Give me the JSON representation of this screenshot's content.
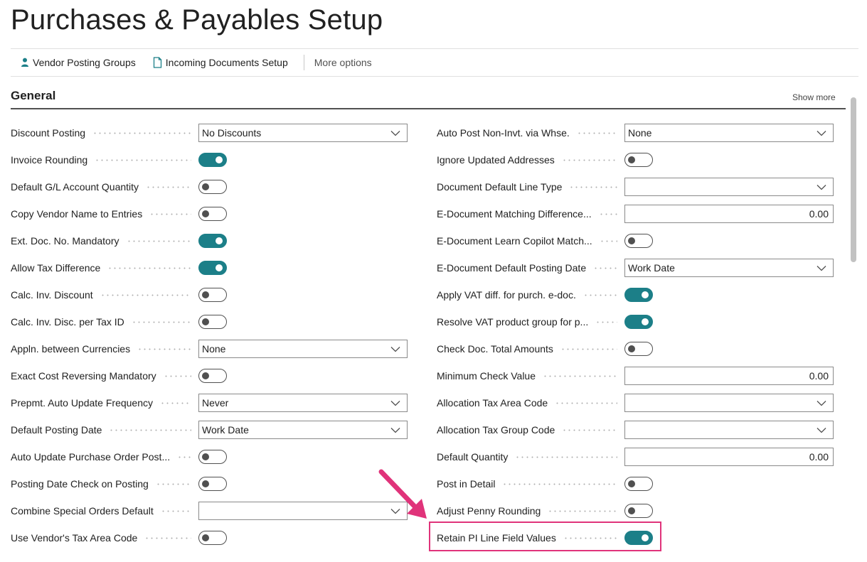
{
  "page": {
    "title": "Purchases & Payables Setup"
  },
  "actions": {
    "vendor_posting_groups": "Vendor Posting Groups",
    "incoming_documents_setup": "Incoming Documents Setup",
    "more_options": "More options"
  },
  "section": {
    "title": "General",
    "show_more": "Show more"
  },
  "left_fields": [
    {
      "name": "discount-posting",
      "label": "Discount Posting",
      "type": "select",
      "value": "No Discounts"
    },
    {
      "name": "invoice-rounding",
      "label": "Invoice Rounding",
      "type": "toggle",
      "on": true
    },
    {
      "name": "default-gl-account-quantity",
      "label": "Default G/L Account Quantity",
      "type": "toggle",
      "on": false
    },
    {
      "name": "copy-vendor-name-to-entries",
      "label": "Copy Vendor Name to Entries",
      "type": "toggle",
      "on": false
    },
    {
      "name": "ext-doc-no-mandatory",
      "label": "Ext. Doc. No. Mandatory",
      "type": "toggle",
      "on": true
    },
    {
      "name": "allow-tax-difference",
      "label": "Allow Tax Difference",
      "type": "toggle",
      "on": true
    },
    {
      "name": "calc-inv-discount",
      "label": "Calc. Inv. Discount",
      "type": "toggle",
      "on": false
    },
    {
      "name": "calc-inv-disc-per-tax-id",
      "label": "Calc. Inv. Disc. per Tax ID",
      "type": "toggle",
      "on": false
    },
    {
      "name": "appln-between-currencies",
      "label": "Appln. between Currencies",
      "type": "select",
      "value": "None"
    },
    {
      "name": "exact-cost-reversing-mandatory",
      "label": "Exact Cost Reversing Mandatory",
      "type": "toggle",
      "on": false
    },
    {
      "name": "prepmt-auto-update-frequency",
      "label": "Prepmt. Auto Update Frequency",
      "type": "select",
      "value": "Never"
    },
    {
      "name": "default-posting-date",
      "label": "Default Posting Date",
      "type": "select",
      "value": "Work Date"
    },
    {
      "name": "auto-update-purchase-order-post",
      "label": "Auto Update Purchase Order Post...",
      "type": "toggle",
      "on": false
    },
    {
      "name": "posting-date-check-on-posting",
      "label": "Posting Date Check on Posting",
      "type": "toggle",
      "on": false
    },
    {
      "name": "combine-special-orders-default",
      "label": "Combine Special Orders Default",
      "type": "select",
      "value": ""
    },
    {
      "name": "use-vendors-tax-area-code",
      "label": "Use Vendor's Tax Area Code",
      "type": "toggle",
      "on": false
    }
  ],
  "right_fields": [
    {
      "name": "auto-post-non-invt-via-whse",
      "label": "Auto Post Non-Invt. via Whse.",
      "type": "select",
      "value": "None"
    },
    {
      "name": "ignore-updated-addresses",
      "label": "Ignore Updated Addresses",
      "type": "toggle",
      "on": false
    },
    {
      "name": "document-default-line-type",
      "label": "Document Default Line Type",
      "type": "select",
      "value": ""
    },
    {
      "name": "e-document-matching-difference",
      "label": "E-Document Matching Difference...",
      "type": "input",
      "value": "0.00"
    },
    {
      "name": "e-document-learn-copilot-match",
      "label": "E-Document Learn Copilot Match...",
      "type": "toggle",
      "on": false
    },
    {
      "name": "e-document-default-posting-date",
      "label": "E-Document Default Posting Date",
      "type": "select",
      "value": "Work Date"
    },
    {
      "name": "apply-vat-diff-for-purch-e-doc",
      "label": "Apply VAT diff. for purch. e-doc.",
      "type": "toggle",
      "on": true
    },
    {
      "name": "resolve-vat-product-group",
      "label": "Resolve VAT product group for p...",
      "type": "toggle",
      "on": true
    },
    {
      "name": "check-doc-total-amounts",
      "label": "Check Doc. Total Amounts",
      "type": "toggle",
      "on": false
    },
    {
      "name": "minimum-check-value",
      "label": "Minimum Check Value",
      "type": "input",
      "value": "0.00"
    },
    {
      "name": "allocation-tax-area-code",
      "label": "Allocation Tax Area Code",
      "type": "select",
      "value": ""
    },
    {
      "name": "allocation-tax-group-code",
      "label": "Allocation Tax Group Code",
      "type": "select",
      "value": ""
    },
    {
      "name": "default-quantity",
      "label": "Default Quantity",
      "type": "input",
      "value": "0.00"
    },
    {
      "name": "post-in-detail",
      "label": "Post in Detail",
      "type": "toggle",
      "on": false
    },
    {
      "name": "adjust-penny-rounding",
      "label": "Adjust Penny Rounding",
      "type": "toggle",
      "on": false
    },
    {
      "name": "retain-pi-line-field-values",
      "label": "Retain PI Line Field Values",
      "type": "toggle",
      "on": true
    }
  ],
  "icons": {
    "vendor_posting_groups": "person-icon",
    "incoming_documents_setup": "document-icon",
    "dropdown": "chevron-down-icon"
  },
  "colors": {
    "toggle_on": "#1c7f88",
    "highlight": "#e0337a",
    "vendor_icon": "#1c7f88"
  }
}
